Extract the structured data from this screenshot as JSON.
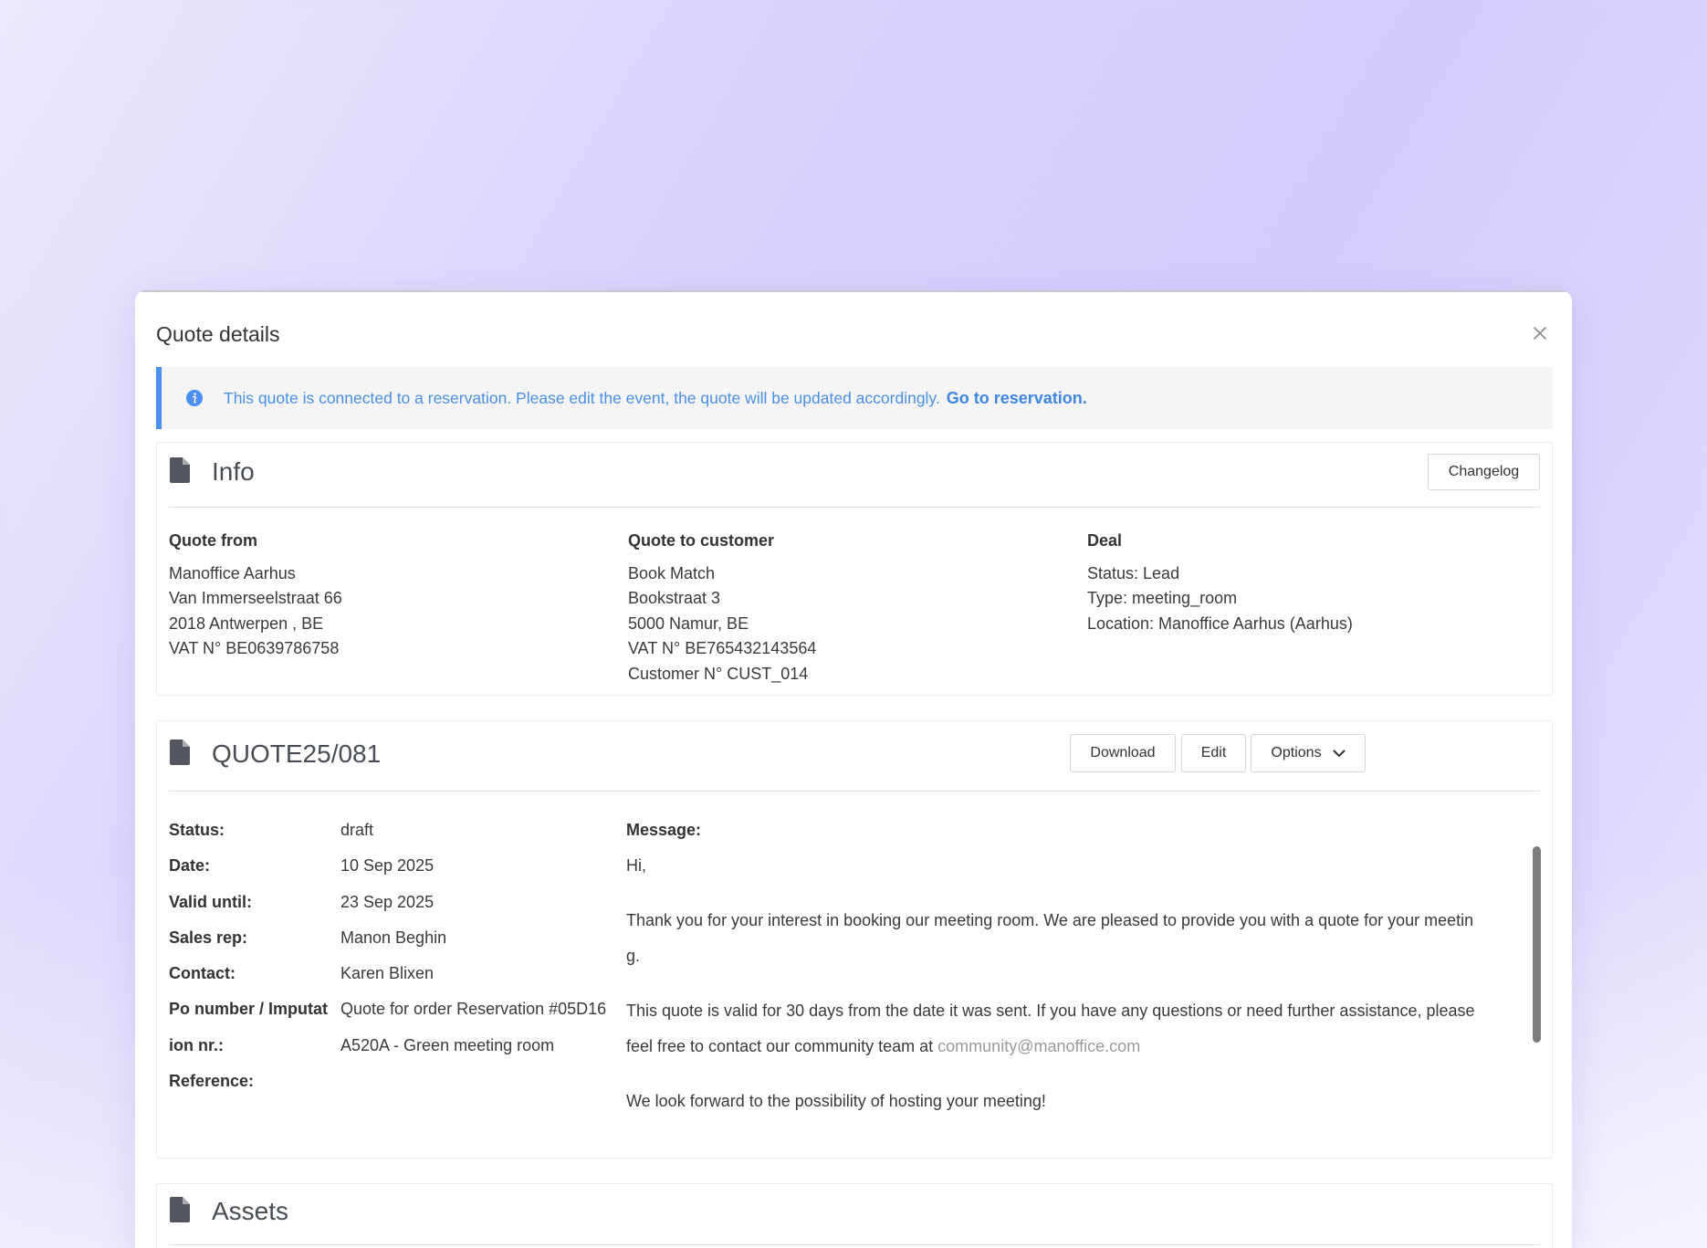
{
  "modal": {
    "title": "Quote details"
  },
  "alert": {
    "text": "This quote is connected to a reservation. Please edit the event, the quote will be updated accordingly.",
    "link": "Go to reservation.",
    "color": "#4a90e2"
  },
  "info": {
    "title": "Info",
    "changelog_label": "Changelog",
    "quote_from": {
      "heading": "Quote from",
      "lines": [
        "Manoffice Aarhus",
        "Van Immerseelstraat 66",
        "2018 Antwerpen , BE",
        "VAT N° BE0639786758"
      ]
    },
    "quote_to": {
      "heading": "Quote to customer",
      "lines": [
        "Book Match",
        "Bookstraat 3",
        "5000 Namur, BE",
        "VAT N° BE765432143564",
        "Customer N° CUST_014"
      ]
    },
    "deal": {
      "heading": "Deal",
      "lines": [
        "Status: Lead",
        "Type: meeting_room",
        "Location: Manoffice Aarhus (Aarhus)"
      ]
    }
  },
  "quote": {
    "title": "QUOTE25/081",
    "download_label": "Download",
    "edit_label": "Edit",
    "options_label": "Options",
    "labels": [
      "Status:",
      "Date:",
      "Valid until:",
      "Sales rep:",
      "Contact:",
      "Po number / Imputat",
      "ion nr.:",
      "Reference:"
    ],
    "values": [
      "draft",
      "10 Sep 2025",
      "23 Sep 2025",
      "Manon Beghin",
      "Karen Blixen",
      "Quote for order Reservation #05D16",
      "A520A - Green meeting room",
      ""
    ],
    "message": {
      "heading": "Message:",
      "greeting": "Hi,",
      "p1_line1": "Thank you for your interest in booking our meeting room. We are pleased to provide you with a quote for your meetin",
      "p1_line2": "g.",
      "p2_line1": "This quote is valid for 30 days from the date it was sent. If you have any questions or need further assistance, please",
      "p2_line2": "feel free to contact our community team at",
      "email": "community@manoffice.com",
      "p3": "We look forward to the possibility of hosting your meeting!"
    }
  },
  "assets": {
    "title": "Assets"
  }
}
